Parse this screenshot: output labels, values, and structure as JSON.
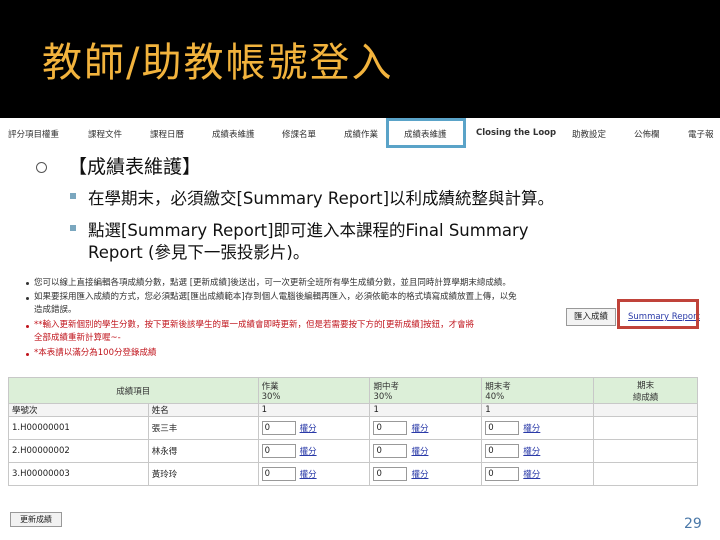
{
  "title": "教師/助教帳號登入",
  "nav": {
    "items": [
      {
        "label": "評分項目權重"
      },
      {
        "label": "課程文件"
      },
      {
        "label": "課程日曆"
      },
      {
        "label": "成績表維護"
      },
      {
        "label": "修課名單"
      },
      {
        "label": "成績作業"
      },
      {
        "label": "成績表維護"
      },
      {
        "label": "Closing the Loop"
      },
      {
        "label": "助教設定"
      },
      {
        "label": "公佈欄"
      },
      {
        "label": "電子報"
      }
    ]
  },
  "slide": {
    "main_bullet": "【成績表維護】",
    "sub_bullets": [
      "在學期末，必須繳交[Summary Report]以利成績統整與計算。",
      "點選[Summary Report]即可進入本課程的Final Summary",
      "Report (參見下一張投影片)。"
    ]
  },
  "notes": [
    "您可以線上直接編輯各項成績分數，點選 [更新成績]後送出，可一次更新全班所有學生成績分數，並且同時計算學期末總成績。",
    "如果要採用匯入成績的方式，您必須點選[匯出成績範本]存到個人電腦後編輯再匯入，必須依範本的格式填寫成績放置上傳，以免",
    "造成錯誤。",
    "**輸入更新個別的學生分數，按下更新後該學生的單一成績會即時更新，但是若需要按下方的[更新成績]按鈕，才會將",
    "全部成績重新計算喔~-",
    "*本表請以滿分為100分登錄成績"
  ],
  "actions": {
    "import_label": "匯入成績",
    "summary_label": "Summary Report",
    "update_label": "更新成績"
  },
  "table": {
    "header_item": "成績項目",
    "columns": [
      {
        "name": "作業",
        "weight": "30%"
      },
      {
        "name": "期中考",
        "weight": "30%"
      },
      {
        "name": "期末考",
        "weight": "40%"
      }
    ],
    "final_col": [
      "期末",
      "總成績"
    ],
    "subheader": [
      "學號次",
      "姓名"
    ],
    "subheader_ones": [
      "1",
      "1",
      "1"
    ],
    "revise_label": "權分",
    "rows": [
      {
        "id": "1.H00000001",
        "name": "張三丰",
        "scores": [
          "0",
          "0",
          "0"
        ]
      },
      {
        "id": "2.H00000002",
        "name": "林永得",
        "scores": [
          "0",
          "0",
          "0"
        ]
      },
      {
        "id": "3.H00000003",
        "name": "黃玲玲",
        "scores": [
          "0",
          "0",
          "0"
        ]
      }
    ]
  },
  "page_number": "29",
  "colors": {
    "title_bg": "#000000",
    "title_text": "#f2b33d",
    "nav_highlight": "#5aa3c8",
    "summary_highlight": "#c0433a",
    "table_header": "#dcefd8",
    "note_red": "#c0141c"
  }
}
